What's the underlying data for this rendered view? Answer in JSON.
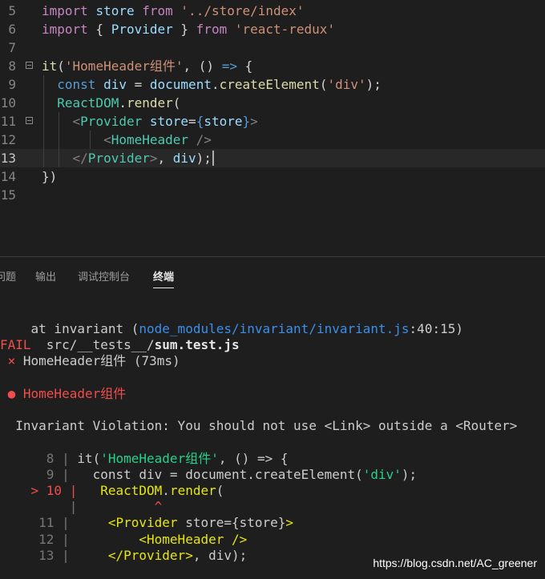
{
  "editor": {
    "lines": [
      {
        "num": "5",
        "parts": [
          [
            "kw",
            "import"
          ],
          [
            "t",
            " "
          ],
          [
            "vr",
            "store"
          ],
          [
            "t",
            " "
          ],
          [
            "kw",
            "from"
          ],
          [
            "t",
            " "
          ],
          [
            "st",
            "'../store/index'"
          ]
        ]
      },
      {
        "num": "6",
        "parts": [
          [
            "kw",
            "import"
          ],
          [
            "t",
            " { "
          ],
          [
            "vr",
            "Provider"
          ],
          [
            "t",
            " } "
          ],
          [
            "kw",
            "from"
          ],
          [
            "t",
            " "
          ],
          [
            "st",
            "'react-redux'"
          ]
        ]
      },
      {
        "num": "7",
        "parts": []
      },
      {
        "num": "8",
        "parts": [
          [
            "fn",
            "it"
          ],
          [
            "t",
            "("
          ],
          [
            "st",
            "'HomeHeader组件'"
          ],
          [
            "t",
            ", () "
          ],
          [
            "kb",
            "=>"
          ],
          [
            "t",
            " {"
          ]
        ]
      },
      {
        "num": "9",
        "parts": [
          [
            "t",
            "  "
          ],
          [
            "kb",
            "const"
          ],
          [
            "t",
            " "
          ],
          [
            "vr",
            "div"
          ],
          [
            "t",
            " = "
          ],
          [
            "vr",
            "document"
          ],
          [
            "t",
            "."
          ],
          [
            "fn",
            "createElement"
          ],
          [
            "t",
            "("
          ],
          [
            "st",
            "'div'"
          ],
          [
            "t",
            ");"
          ]
        ]
      },
      {
        "num": "10",
        "parts": [
          [
            "t",
            "  "
          ],
          [
            "ty",
            "ReactDOM"
          ],
          [
            "t",
            "."
          ],
          [
            "fn",
            "render"
          ],
          [
            "t",
            "("
          ]
        ]
      },
      {
        "num": "11",
        "parts": [
          [
            "t",
            "    "
          ],
          [
            "tb",
            "<"
          ],
          [
            "tg",
            "Provider"
          ],
          [
            "t",
            " "
          ],
          [
            "vr",
            "store"
          ],
          [
            "t",
            "="
          ],
          [
            "kb",
            "{"
          ],
          [
            "vr",
            "store"
          ],
          [
            "kb",
            "}"
          ],
          [
            "tb",
            ">"
          ]
        ]
      },
      {
        "num": "12",
        "parts": [
          [
            "t",
            "        "
          ],
          [
            "tb",
            "<"
          ],
          [
            "tg",
            "HomeHeader"
          ],
          [
            "t",
            " "
          ],
          [
            "tb",
            "/>"
          ]
        ]
      },
      {
        "num": "13",
        "parts": [
          [
            "t",
            "    "
          ],
          [
            "tb",
            "</"
          ],
          [
            "tg",
            "Provider"
          ],
          [
            "tb",
            ">"
          ],
          [
            "t",
            ", "
          ],
          [
            "vr",
            "div"
          ],
          [
            "t",
            ");"
          ]
        ]
      },
      {
        "num": "14",
        "parts": [
          [
            "t",
            "})"
          ]
        ]
      },
      {
        "num": "15",
        "parts": []
      }
    ]
  },
  "panel": {
    "tabs": [
      {
        "label": "问题",
        "active": false
      },
      {
        "label": "输出",
        "active": false
      },
      {
        "label": "调试控制台",
        "active": false
      },
      {
        "label": "终端",
        "active": true
      }
    ],
    "terminal": [
      [
        [
          "t",
          "    at invariant ("
        ],
        [
          "path",
          "node_modules/invariant/invariant.js"
        ],
        [
          "t",
          ":40:15)"
        ]
      ],
      [
        [
          "fail",
          "FAIL"
        ],
        [
          "t",
          "  src/__tests__/"
        ],
        [
          "bold",
          "sum.test.js"
        ]
      ],
      [
        [
          "red",
          " ×"
        ],
        [
          "t",
          " HomeHeader组件 (73ms)"
        ]
      ],
      [],
      [
        [
          "red",
          " ● HomeHeader组件"
        ]
      ],
      [],
      [
        [
          "t",
          "  Invariant Violation: You should not use <Link> outside a <Router>"
        ]
      ],
      [],
      [
        [
          "dim",
          "      8 | "
        ],
        [
          "t",
          "it("
        ],
        [
          "grn",
          "'HomeHeader组件'"
        ],
        [
          "t",
          ", () => {"
        ]
      ],
      [
        [
          "dim",
          "      9 | "
        ],
        [
          "t",
          "  const div = document.createElement("
        ],
        [
          "grn",
          "'div'"
        ],
        [
          "t",
          ");"
        ]
      ],
      [
        [
          "red",
          "    > 10 | "
        ],
        [
          "yel",
          "  ReactDOM"
        ],
        [
          "t",
          "."
        ],
        [
          "yel",
          "render"
        ],
        [
          "t",
          "("
        ]
      ],
      [
        [
          "dim",
          "         | "
        ],
        [
          "red",
          "         ^"
        ]
      ],
      [
        [
          "dim",
          "     11 | "
        ],
        [
          "yel",
          "    <Provider"
        ],
        [
          "t",
          " store={store}"
        ],
        [
          "yel",
          ">"
        ]
      ],
      [
        [
          "dim",
          "     12 | "
        ],
        [
          "yel",
          "        <HomeHeader />"
        ]
      ],
      [
        [
          "dim",
          "     13 | "
        ],
        [
          "yel",
          "    </Provider>"
        ],
        [
          "t",
          ", div);"
        ]
      ]
    ]
  },
  "watermark": "https://blog.csdn.net/AC_greener"
}
